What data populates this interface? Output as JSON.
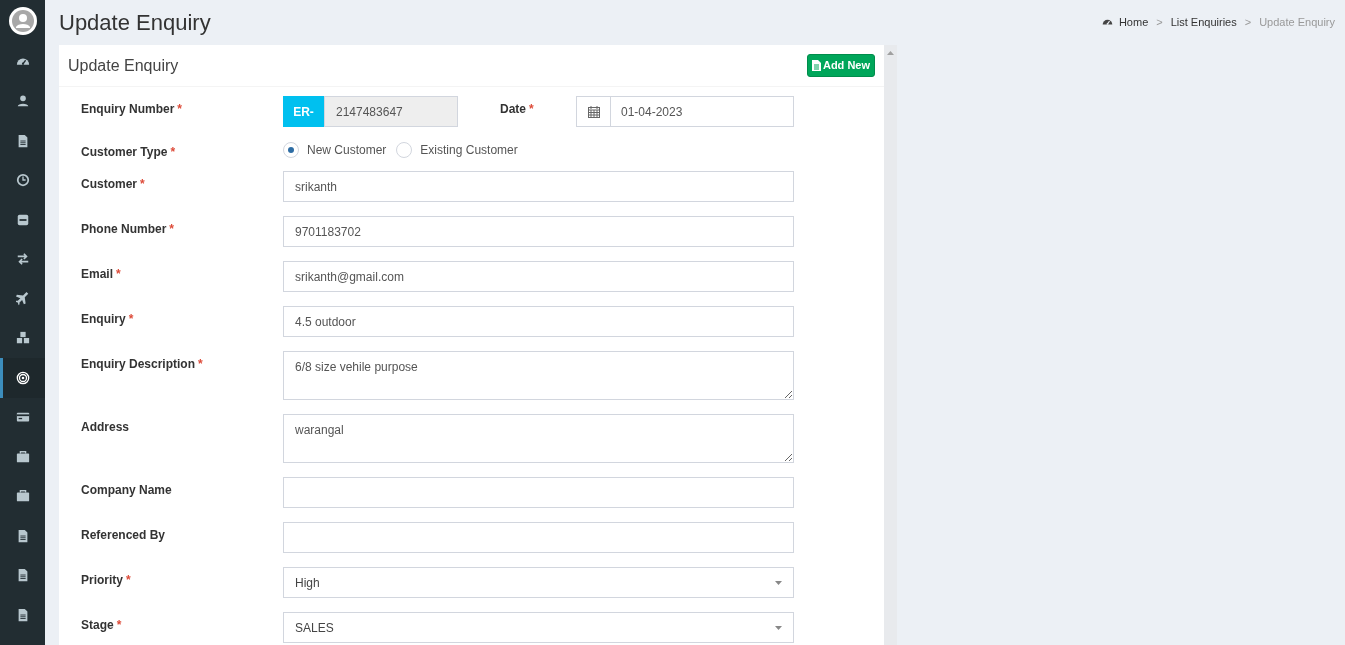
{
  "sidebar": {
    "items": [
      {
        "kind": "dashboard",
        "selected": false
      },
      {
        "kind": "user",
        "selected": false
      },
      {
        "kind": "file",
        "selected": false
      },
      {
        "kind": "clock",
        "selected": false
      },
      {
        "kind": "minus",
        "selected": false
      },
      {
        "kind": "exchange",
        "selected": false
      },
      {
        "kind": "plane",
        "selected": false
      },
      {
        "kind": "cubes",
        "selected": false
      },
      {
        "kind": "target",
        "selected": true
      },
      {
        "kind": "card",
        "selected": false
      },
      {
        "kind": "briefcase",
        "selected": false
      },
      {
        "kind": "briefcase",
        "selected": false
      },
      {
        "kind": "file",
        "selected": false
      },
      {
        "kind": "file",
        "selected": false
      },
      {
        "kind": "file",
        "selected": false
      }
    ]
  },
  "page_title": "Update Enquiry",
  "breadcrumb": {
    "separator": ">",
    "items": [
      {
        "label": "Home",
        "kind": "dashboard",
        "current": false
      },
      {
        "label": "List Enquiries",
        "current": false
      },
      {
        "label": "Update Enquiry",
        "current": true
      }
    ]
  },
  "card": {
    "title": "Update Enquiry",
    "add_button": "Add New",
    "required_mark": "*",
    "rows": [
      [
        {
          "kind": "prefix",
          "label": "Enquiry Number",
          "required": true,
          "prefix": "ER-",
          "value": "2147483647"
        },
        {
          "kind": "date",
          "label": "Date",
          "required": true,
          "value": "01-04-2023"
        }
      ],
      [
        {
          "kind": "radio",
          "label": "Customer Type",
          "required": true,
          "options": [
            {
              "label": "New Customer",
              "selected": true
            },
            {
              "label": "Existing Customer",
              "selected": false
            }
          ]
        }
      ],
      [
        {
          "kind": "text",
          "label": "Customer",
          "required": true,
          "value": "srikanth"
        }
      ],
      [
        {
          "kind": "text",
          "label": "Phone Number",
          "required": true,
          "value": "9701183702"
        }
      ],
      [
        {
          "kind": "text",
          "label": "Email",
          "required": true,
          "value": "srikanth@gmail.com"
        }
      ],
      [
        {
          "kind": "text",
          "label": "Enquiry",
          "required": true,
          "value": "4.5 outdoor"
        }
      ],
      [
        {
          "kind": "textarea",
          "label": "Enquiry Description",
          "required": true,
          "value": "6/8 size vehile purpose"
        }
      ],
      [
        {
          "kind": "textarea",
          "label": "Address",
          "required": false,
          "value": "warangal"
        }
      ],
      [
        {
          "kind": "text",
          "label": "Company Name",
          "required": false
        }
      ],
      [
        {
          "kind": "text",
          "label": "Referenced By",
          "required": false
        }
      ],
      [
        {
          "kind": "select",
          "label": "Priority",
          "required": true,
          "value": "High"
        }
      ],
      [
        {
          "kind": "select",
          "label": "Stage",
          "required": true,
          "value": "SALES"
        }
      ]
    ]
  }
}
